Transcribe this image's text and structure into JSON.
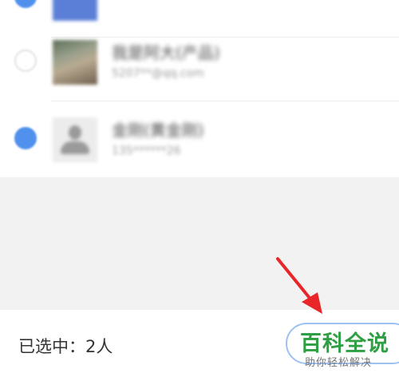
{
  "contacts": [
    {
      "name": "",
      "detail": "",
      "selected": true,
      "avatar": "partial-avatar"
    },
    {
      "name": "我是阿大(产品)",
      "detail": "5207**@qq.com",
      "selected": false,
      "avatar": "photo-avatar"
    },
    {
      "name": "金刚(黄金刚)",
      "detail": "135******26",
      "selected": true,
      "avatar": "default-avatar"
    }
  ],
  "footer": {
    "selected_label": "已选中：2人",
    "confirm_label": ""
  },
  "watermark": {
    "title": "百科全说",
    "subtitle": "助你轻松解决"
  },
  "colors": {
    "accent": "#4f91ec",
    "arrow": "#e8262a",
    "watermark_green": "#2ea043"
  }
}
